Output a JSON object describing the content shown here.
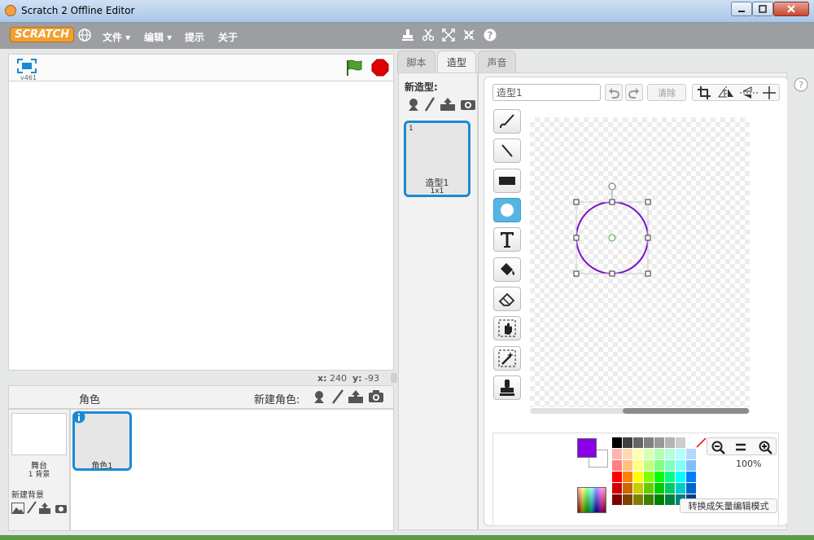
{
  "window": {
    "title": "Scratch 2 Offline Editor"
  },
  "menubar": {
    "logo": "SCRATCH",
    "items": [
      "文件 ▾",
      "编辑 ▾",
      "提示",
      "关于"
    ]
  },
  "stage": {
    "version": "v461",
    "x_label": "x:",
    "x_value": "240",
    "y_label": "y:",
    "y_value": "-93"
  },
  "sprites": {
    "header": "角色",
    "new_sprite_label": "新建角色:",
    "stage_label": "舞台",
    "backdrop_count": "1 背景",
    "new_backdrop_label": "新建背景",
    "items": [
      {
        "name": "角色1"
      }
    ]
  },
  "tabs": [
    "脚本",
    "造型",
    "声音"
  ],
  "costumes": {
    "new_label": "新造型:",
    "items": [
      {
        "index": "1",
        "name": "造型1",
        "size": "1x1"
      }
    ]
  },
  "editor": {
    "costume_name": "造型1",
    "clear_label": "清除",
    "zoom_value": "100%",
    "convert_button": "转换成矢量编辑模式",
    "primary_color": "#8a00e6"
  },
  "palette": [
    "#000000",
    "#404040",
    "#666666",
    "#808080",
    "#999999",
    "#b3b3b3",
    "#cccccc",
    "#ffffff",
    "#ffb3b3",
    "#ffd9b3",
    "#ffffb3",
    "#d9ffb3",
    "#b3ffb3",
    "#b3ffd9",
    "#b3ffff",
    "#b3d9ff",
    "#ff8080",
    "#ffbf80",
    "#ffff80",
    "#bfff80",
    "#80ff80",
    "#80ffbf",
    "#80ffff",
    "#80bfff",
    "#ff0000",
    "#ff8000",
    "#ffff00",
    "#80ff00",
    "#00ff00",
    "#00ff80",
    "#00ffff",
    "#0080ff",
    "#cc0000",
    "#cc6600",
    "#cccc00",
    "#66cc00",
    "#00cc00",
    "#00cc66",
    "#00cccc",
    "#0066cc",
    "#800000",
    "#804000",
    "#808000",
    "#408000",
    "#008000",
    "#008040",
    "#008080",
    "#004080"
  ]
}
